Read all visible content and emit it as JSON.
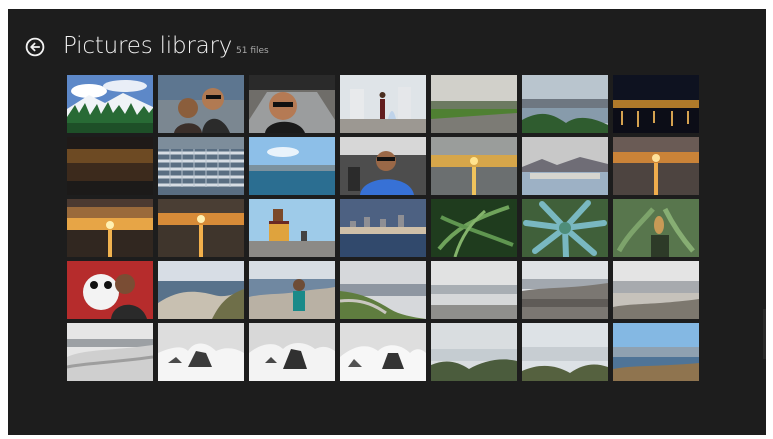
{
  "header": {
    "title": "Pictures library",
    "count": "51 files"
  },
  "icons": {
    "back": "back-arrow-icon"
  },
  "colors": {
    "background": "#1d1d1d",
    "title": "#f2f2f2",
    "count": "#a9a9a9"
  }
}
